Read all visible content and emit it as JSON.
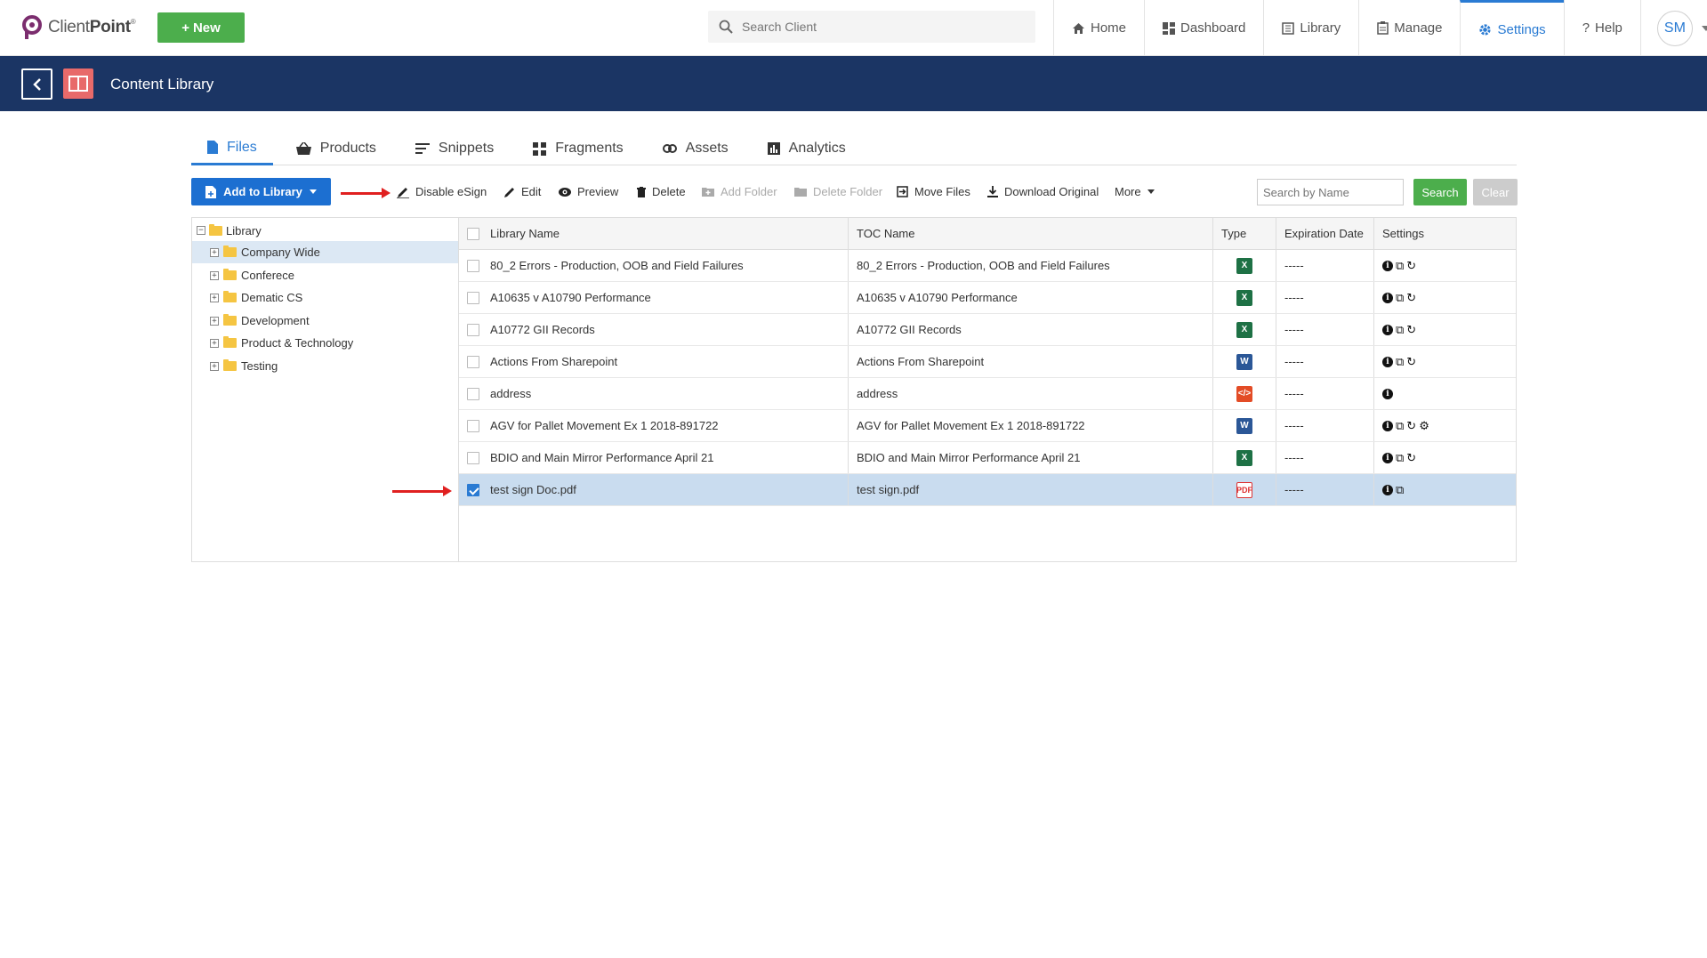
{
  "app": {
    "logo_text": "ClientPoint",
    "logo_sup": "®",
    "new_label": "New",
    "search_placeholder": "Search Client"
  },
  "nav": {
    "items": [
      {
        "label": "Home",
        "icon": "home-icon"
      },
      {
        "label": "Dashboard",
        "icon": "dashboard-icon"
      },
      {
        "label": "Library",
        "icon": "library-icon"
      },
      {
        "label": "Manage",
        "icon": "manage-icon"
      },
      {
        "label": "Settings",
        "icon": "gear-icon",
        "active": true
      },
      {
        "label": "Help",
        "icon": "help-icon"
      }
    ],
    "avatar_initials": "SM"
  },
  "header": {
    "title": "Content Library"
  },
  "tabs": [
    {
      "label": "Files",
      "icon": "file-icon",
      "active": true
    },
    {
      "label": "Products",
      "icon": "basket-icon"
    },
    {
      "label": "Snippets",
      "icon": "snippets-icon"
    },
    {
      "label": "Fragments",
      "icon": "fragments-icon"
    },
    {
      "label": "Assets",
      "icon": "link-icon"
    },
    {
      "label": "Analytics",
      "icon": "analytics-icon"
    }
  ],
  "toolbar": {
    "add_label": "Add to Library",
    "actions": [
      {
        "label": "Disable eSign",
        "icon": "pen-icon",
        "enabled": true
      },
      {
        "label": "Edit",
        "icon": "pencil-icon",
        "enabled": true
      },
      {
        "label": "Preview",
        "icon": "eye-icon",
        "enabled": true
      },
      {
        "label": "Delete",
        "icon": "trash-icon",
        "enabled": true
      },
      {
        "label": "Add Folder",
        "icon": "folder-plus-icon",
        "enabled": false
      },
      {
        "label": "Delete Folder",
        "icon": "folder-icon",
        "enabled": false
      },
      {
        "label": "Move Files",
        "icon": "move-icon",
        "enabled": true
      },
      {
        "label": "Download Original",
        "icon": "download-icon",
        "enabled": true
      },
      {
        "label": "More",
        "icon": "caret-down-icon",
        "enabled": true
      }
    ],
    "search_placeholder": "Search by Name",
    "search_label": "Search",
    "clear_label": "Clear"
  },
  "tree": {
    "root": "Library",
    "items": [
      {
        "label": "Company Wide",
        "selected": true
      },
      {
        "label": "Conferece"
      },
      {
        "label": "Dematic CS"
      },
      {
        "label": "Development"
      },
      {
        "label": "Product & Technology"
      },
      {
        "label": "Testing"
      }
    ]
  },
  "grid": {
    "headers": {
      "library_name": "Library Name",
      "toc_name": "TOC Name",
      "type": "Type",
      "expiration": "Expiration Date",
      "settings": "Settings"
    },
    "rows": [
      {
        "library_name": "80_2 Errors - Production, OOB and Field Failures",
        "toc_name": "80_2 Errors - Production, OOB and Field Failures",
        "type": "xlsx",
        "expiration": "-----",
        "settings": [
          "info",
          "copy",
          "sync"
        ],
        "checked": false
      },
      {
        "library_name": "A10635 v A10790 Performance",
        "toc_name": "A10635 v A10790 Performance",
        "type": "xlsx",
        "expiration": "-----",
        "settings": [
          "info",
          "copy",
          "sync"
        ],
        "checked": false
      },
      {
        "library_name": "A10772 GII Records",
        "toc_name": "A10772 GII Records",
        "type": "xlsx",
        "expiration": "-----",
        "settings": [
          "info",
          "copy",
          "sync"
        ],
        "checked": false
      },
      {
        "library_name": "Actions From Sharepoint",
        "toc_name": "Actions From Sharepoint",
        "type": "docx",
        "expiration": "-----",
        "settings": [
          "info",
          "copy",
          "sync"
        ],
        "checked": false
      },
      {
        "library_name": "address",
        "toc_name": "address",
        "type": "html",
        "expiration": "-----",
        "settings": [
          "info"
        ],
        "checked": false
      },
      {
        "library_name": "AGV for Pallet Movement Ex 1 2018-891722",
        "toc_name": "AGV for Pallet Movement Ex 1 2018-891722",
        "type": "docx",
        "expiration": "-----",
        "settings": [
          "info",
          "copy",
          "sync",
          "gear"
        ],
        "checked": false
      },
      {
        "library_name": "BDIO and Main Mirror Performance April 21",
        "toc_name": "BDIO and Main Mirror Performance April 21",
        "type": "xlsx",
        "expiration": "-----",
        "settings": [
          "info",
          "copy",
          "sync"
        ],
        "checked": false
      },
      {
        "library_name": "test sign Doc.pdf",
        "toc_name": "test sign.pdf",
        "type": "pdf",
        "expiration": "-----",
        "settings": [
          "info",
          "copy"
        ],
        "checked": true
      }
    ]
  }
}
